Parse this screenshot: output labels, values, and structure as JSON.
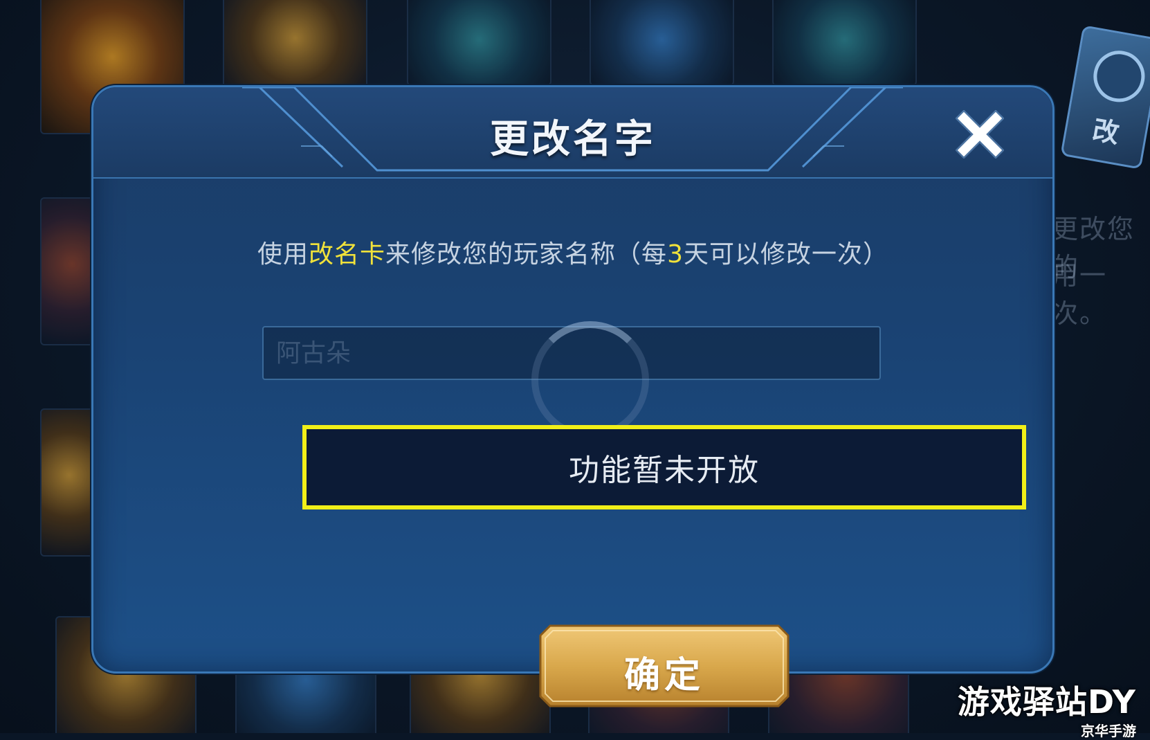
{
  "dialog": {
    "title": "更改名字",
    "instruction": {
      "part1": "使用",
      "highlight1": "改名卡",
      "part2": "来修改您的玩家名称（每",
      "highlight2": "3",
      "part3": "天可以修改一次）"
    },
    "name_input_placeholder": "阿古朵",
    "toast": "功能暂未开放",
    "confirm_label": "确定"
  },
  "background": {
    "side_text_line1": "更改您的",
    "side_text_line2": "用一次。",
    "rename_card_text": "改"
  },
  "watermark": {
    "main": "游戏驿站DY",
    "sub": "京华手游"
  },
  "colors": {
    "highlight": "#f1e23a",
    "toast_border": "#f1ef18",
    "dialog_border": "#3a78b6",
    "confirm_gold": "#d9a84c"
  },
  "icons": {
    "close": "close-icon"
  }
}
